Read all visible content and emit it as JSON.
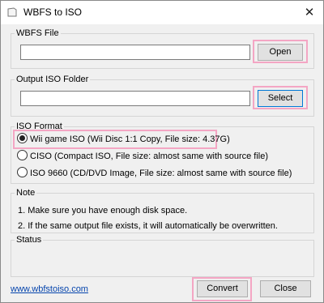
{
  "window": {
    "title": "WBFS to ISO",
    "close_glyph": "✕"
  },
  "wbfs_file": {
    "label": "WBFS File",
    "value": "",
    "open_label": "Open"
  },
  "output_folder": {
    "label": "Output ISO Folder",
    "value": "",
    "select_label": "Select"
  },
  "iso_format": {
    "label": "ISO Format",
    "options": [
      {
        "label": "Wii game ISO (Wii Disc 1:1 Copy, File size: 4.37G)",
        "selected": true
      },
      {
        "label": "CISO (Compact ISO, File size: almost same with source file)",
        "selected": false
      },
      {
        "label": "ISO 9660 (CD/DVD Image, File size: almost same with source file)",
        "selected": false
      }
    ]
  },
  "note": {
    "label": "Note",
    "lines": [
      "1. Make sure you have enough disk space.",
      "2. If the same output file exists, it will automatically be overwritten."
    ]
  },
  "status": {
    "label": "Status",
    "text": ""
  },
  "footer": {
    "website": "www.wbfstoiso.com",
    "convert_label": "Convert",
    "close_label": "Close"
  },
  "colors": {
    "highlight": "#f4a6c4",
    "link": "#0645ad",
    "focus_border": "#0078d7"
  }
}
